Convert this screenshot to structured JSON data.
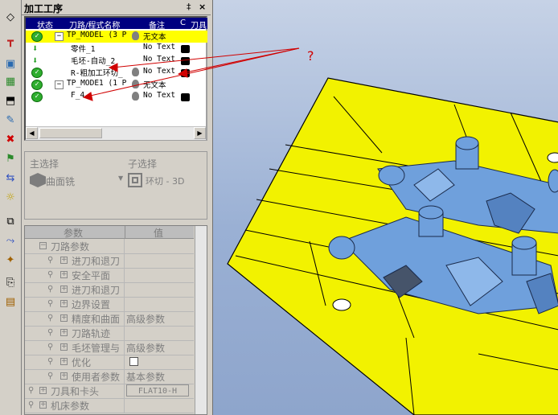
{
  "panel": {
    "title": "加工工序",
    "pin_icon": "pin-icon",
    "close_label": "×"
  },
  "tree": {
    "columns": [
      "状态",
      "刀路/程式名称",
      "备注",
      "C",
      "刀具"
    ],
    "rows": [
      {
        "name": "TP_MODEL (3 P",
        "note": "无文本",
        "icon": "check-icon",
        "selected": true
      },
      {
        "name": "零件_1",
        "note": "No Text",
        "icon": "tool-green-icon"
      },
      {
        "name": "毛坯-自动_2",
        "note": "No Text",
        "icon": "tool-green-icon"
      },
      {
        "name": "R-粗加工环切_",
        "note": "No Text",
        "icon": "check-icon"
      },
      {
        "name": "TP_MODE1 (1 P",
        "note": "无文本",
        "icon": "check-icon"
      },
      {
        "name": "F_4",
        "note": "No Text",
        "icon": "check-icon"
      }
    ]
  },
  "selection": {
    "main_label": "主选择",
    "main_value": "曲面铣",
    "sub_label": "子选择",
    "sub_value": "环切 - 3D"
  },
  "params": {
    "header_param": "参数",
    "header_value": "值",
    "rows": [
      {
        "label": "刀路参数",
        "value": "",
        "level": 1,
        "type": "group"
      },
      {
        "label": "进刀和退刀",
        "value": "",
        "level": 2
      },
      {
        "label": "安全平面",
        "value": "",
        "level": 2
      },
      {
        "label": "进刀和退刀",
        "value": "",
        "level": 2
      },
      {
        "label": "边界设置",
        "value": "",
        "level": 2
      },
      {
        "label": "精度和曲面",
        "value": "高级参数",
        "level": 2
      },
      {
        "label": "刀路轨迹",
        "value": "",
        "level": 2
      },
      {
        "label": "毛坯管理与",
        "value": "高级参数",
        "level": 2
      },
      {
        "label": "优化",
        "value": "",
        "level": 2,
        "checkbox": true
      },
      {
        "label": "使用者参数",
        "value": "基本参数",
        "level": 2
      },
      {
        "label": "刀具和卡头",
        "value": "FLAT10-H",
        "level": 0
      },
      {
        "label": "机床参数",
        "value": "",
        "level": 0
      }
    ]
  },
  "annotation": {
    "question_mark": "?"
  },
  "colors": {
    "selection_highlight": "#ffff00",
    "tree_header": "#000080",
    "part_surface": "#f2f200",
    "part_feature": "#6fa0dc",
    "annotation_arrow": "#d00000"
  },
  "toolbar_icons": [
    "surface-icon",
    "tool-icon",
    "blank-icon",
    "milling-icon",
    "part-icon",
    "edit-icon",
    "delete-icon",
    "simulate-icon",
    "link-icon",
    "bulb-icon",
    "stock-icon",
    "path-icon",
    "tag-icon",
    "copy-icon",
    "report-icon"
  ]
}
